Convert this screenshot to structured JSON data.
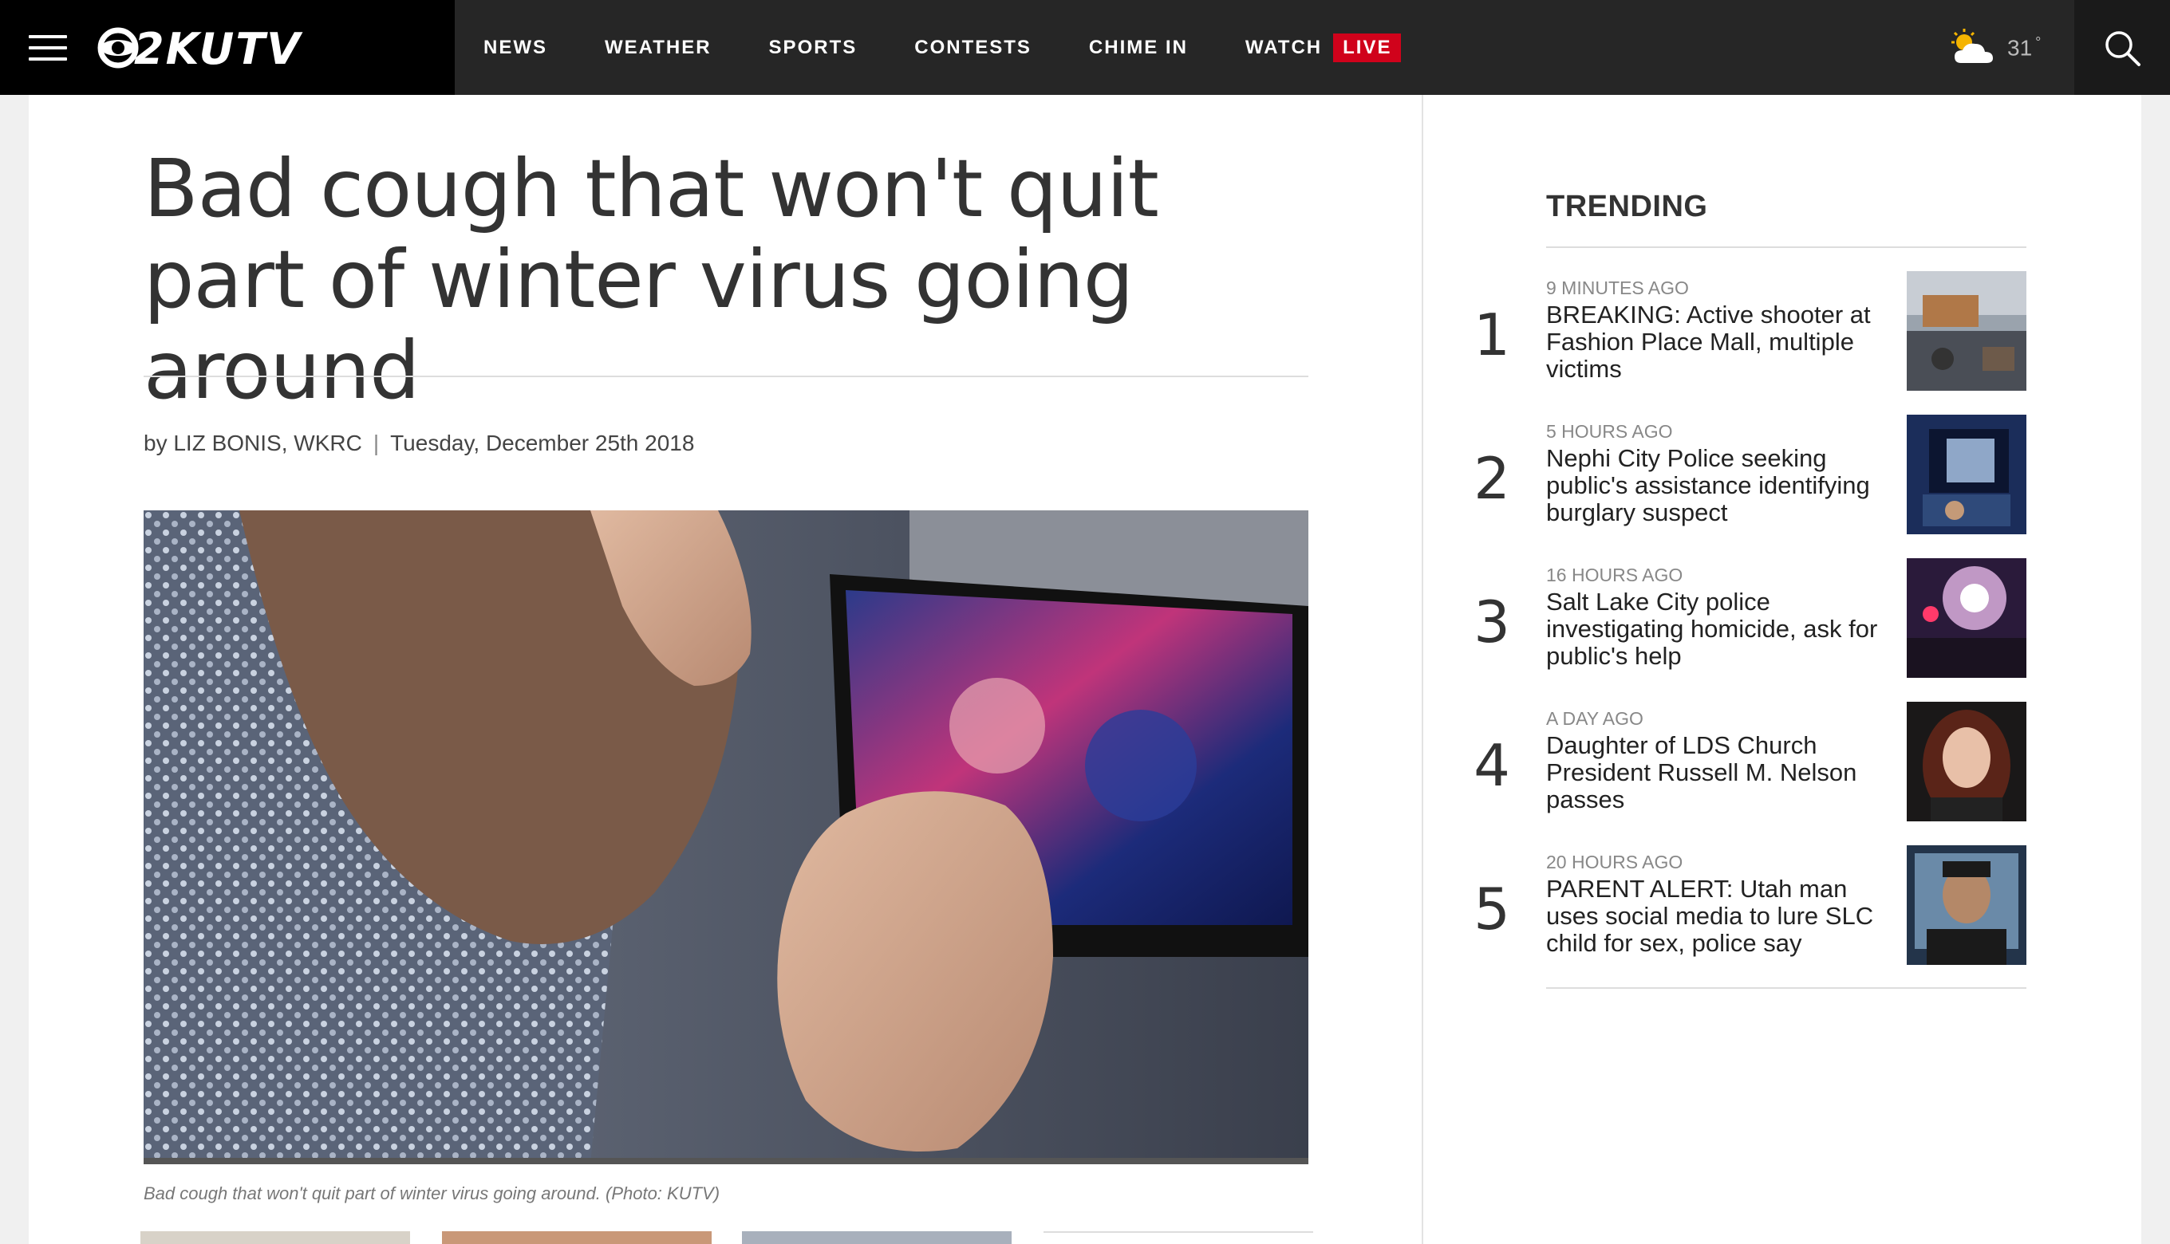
{
  "header": {
    "logo_text": "2KUTV",
    "nav": [
      {
        "label": "NEWS"
      },
      {
        "label": "WEATHER"
      },
      {
        "label": "SPORTS"
      },
      {
        "label": "CONTESTS"
      },
      {
        "label": "CHIME IN"
      },
      {
        "label": "WATCH"
      }
    ],
    "live_label": "LIVE",
    "temperature": "31",
    "degree": "°"
  },
  "article": {
    "headline": "Bad cough that won't quit part of winter virus going around",
    "author": "by LIZ BONIS, WKRC",
    "separator": "|",
    "date": "Tuesday, December 25th 2018",
    "caption": "Bad cough that won't quit part of winter virus going around. (Photo: KUTV)"
  },
  "trending": {
    "title": "TRENDING",
    "items": [
      {
        "rank": "1",
        "time": "9 MINUTES AGO",
        "headline": "BREAKING: Active shooter at Fashion Place Mall, multiple victims"
      },
      {
        "rank": "2",
        "time": "5 HOURS AGO",
        "headline": "Nephi City Police seeking public's assistance identifying burglary suspect"
      },
      {
        "rank": "3",
        "time": "16 HOURS AGO",
        "headline": "Salt Lake City police investigating homicide, ask for public's help"
      },
      {
        "rank": "4",
        "time": "A DAY AGO",
        "headline": "Daughter of LDS Church President Russell M. Nelson passes"
      },
      {
        "rank": "5",
        "time": "20 HOURS AGO",
        "headline": "PARENT ALERT: Utah man uses social media to lure SLC child for sex, police say"
      }
    ]
  },
  "colors": {
    "header_bg": "#262626",
    "brand_bg": "#000000",
    "live_red": "#d0021b"
  },
  "icons": [
    "menu-icon",
    "cbs-eye-icon",
    "partly-cloudy-icon",
    "search-icon"
  ]
}
